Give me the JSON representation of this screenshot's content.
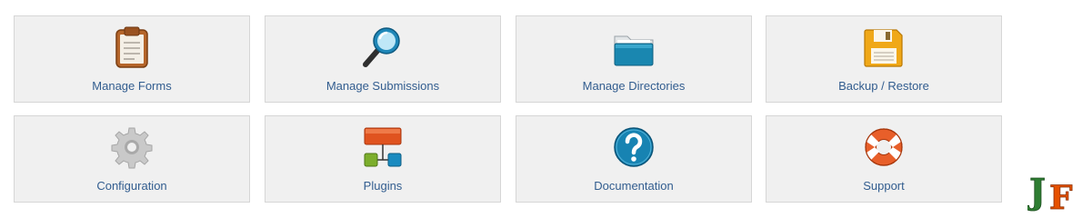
{
  "tiles": [
    {
      "label": "Manage Forms",
      "icon": "clipboard-icon"
    },
    {
      "label": "Manage Submissions",
      "icon": "magnifier-icon"
    },
    {
      "label": "Manage Directories",
      "icon": "folder-icon"
    },
    {
      "label": "Backup / Restore",
      "icon": "floppy-disk-icon"
    },
    {
      "label": "Configuration",
      "icon": "gear-icon"
    },
    {
      "label": "Plugins",
      "icon": "plugin-hierarchy-icon"
    },
    {
      "label": "Documentation",
      "icon": "question-mark-icon"
    },
    {
      "label": "Support",
      "icon": "lifebuoy-icon"
    }
  ],
  "logo": {
    "text": "JF",
    "colors": [
      "#2e7d32",
      "#e65100"
    ]
  },
  "colors": {
    "tile_bg": "#f0f0f0",
    "tile_border": "#d6d6d6",
    "label": "#325d8f"
  }
}
